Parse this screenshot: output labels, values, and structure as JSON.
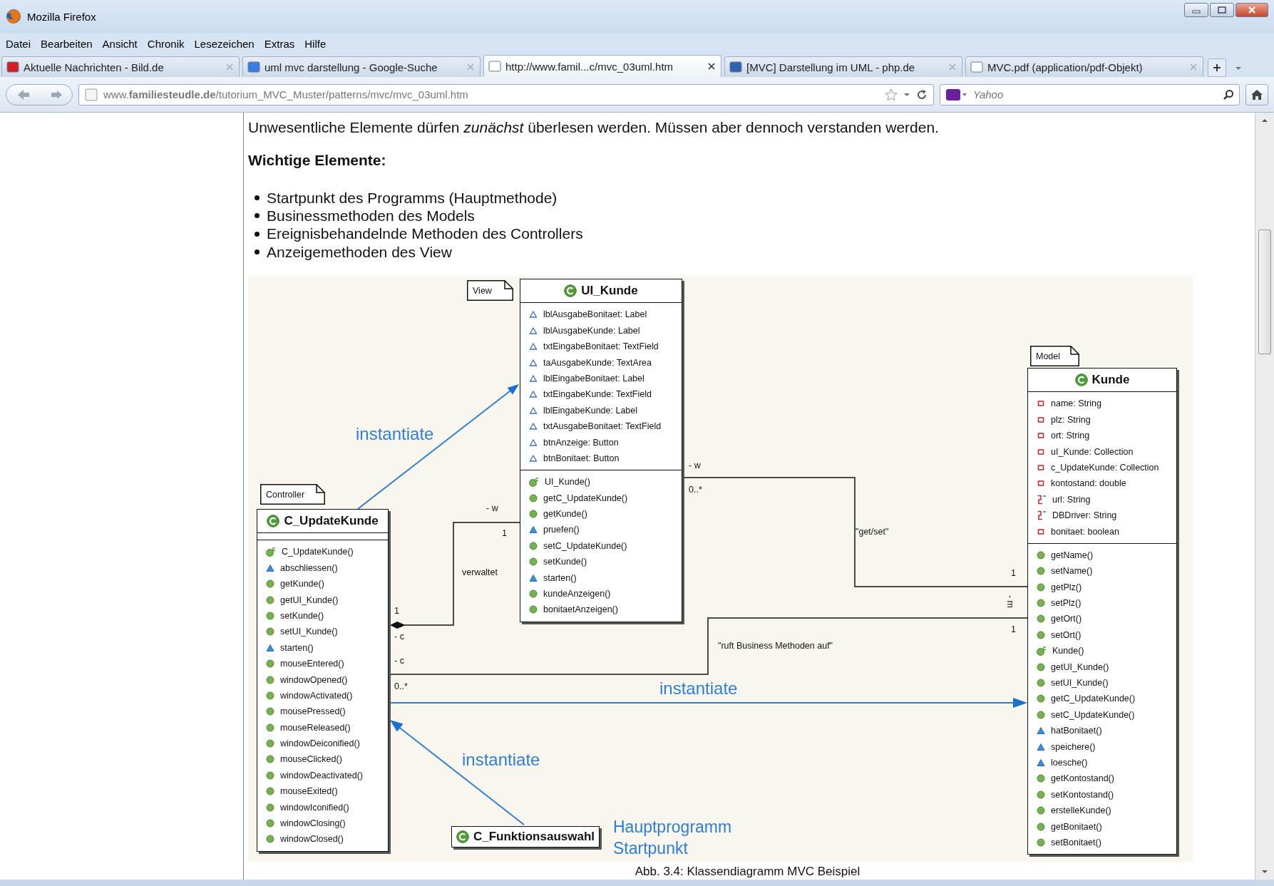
{
  "window": {
    "title": "Mozilla Firefox"
  },
  "menu": [
    "Datei",
    "Bearbeiten",
    "Ansicht",
    "Chronik",
    "Lesezeichen",
    "Extras",
    "Hilfe"
  ],
  "tabs": [
    {
      "label": "Aktuelle Nachrichten - Bild.de",
      "selected": false
    },
    {
      "label": "uml mvc darstellung - Google-Suche",
      "selected": false
    },
    {
      "label": "http://www.famil...c/mvc_03uml.htm",
      "selected": true
    },
    {
      "label": "[MVC] Darstellung im UML - php.de",
      "selected": false
    },
    {
      "label": "MVC.pdf (application/pdf-Objekt)",
      "selected": false
    }
  ],
  "address_bar": {
    "url": "www.**familiesteudle.de**/tutorium_MVC_Muster/patterns/mvc/mvc_03uml.htm"
  },
  "search": {
    "placeholder": "Yahoo"
  },
  "page": {
    "intro": "Unwesentliche Elemente dürfen *zunächst* überlesen werden. Müssen aber dennoch verstanden werden.",
    "heading": "Wichtige Elemente:",
    "bullets": [
      "Startpunkt des Programms (Hauptmethode)",
      "Businessmethoden des Models",
      "Ereignisbehandelnde Methoden des Controllers",
      "Anzeigemethoden des View"
    ],
    "diagram": {
      "packages": [
        "View",
        "Controller",
        "Model"
      ],
      "classes": [
        {
          "name": "UI_Kunde",
          "attributes": [
            {
              "kind": "package-field",
              "text": "lblAusgabeBonitaet: Label"
            },
            {
              "kind": "package-field",
              "text": "lblAusgabeKunde: Label"
            },
            {
              "kind": "package-field",
              "text": "txtEingabeBonitaet: TextField"
            },
            {
              "kind": "package-field",
              "text": "taAusgabeKunde: TextArea"
            },
            {
              "kind": "package-field",
              "text": "lblEingabeBonitaet: Label"
            },
            {
              "kind": "package-field",
              "text": "txtEingabeKunde: TextField"
            },
            {
              "kind": "package-field",
              "text": "lblEingabeKunde: Label"
            },
            {
              "kind": "package-field",
              "text": "txtAusgabeBonitaet: TextField"
            },
            {
              "kind": "package-field",
              "text": "btnAnzeige: Button"
            },
            {
              "kind": "package-field",
              "text": "btnBonitaet: Button"
            }
          ],
          "methods": [
            {
              "kind": "constructor",
              "text": "UI_Kunde()"
            },
            {
              "kind": "public",
              "text": "getC_UpdateKunde()"
            },
            {
              "kind": "public",
              "text": "getKunde()"
            },
            {
              "kind": "package",
              "text": "pruefen()"
            },
            {
              "kind": "public",
              "text": "setC_UpdateKunde()"
            },
            {
              "kind": "public",
              "text": "setKunde()"
            },
            {
              "kind": "package",
              "text": "starten()"
            },
            {
              "kind": "public",
              "text": "kundeAnzeigen()"
            },
            {
              "kind": "public",
              "text": "bonitaetAnzeigen()"
            }
          ]
        },
        {
          "name": "C_UpdateKunde",
          "methods": [
            {
              "kind": "constructor",
              "text": "C_UpdateKunde()"
            },
            {
              "kind": "package",
              "text": "abschliessen()"
            },
            {
              "kind": "public",
              "text": "getKunde()"
            },
            {
              "kind": "public",
              "text": "getUI_Kunde()"
            },
            {
              "kind": "public",
              "text": "setKunde()"
            },
            {
              "kind": "public",
              "text": "setUI_Kunde()"
            },
            {
              "kind": "package",
              "text": "starten()"
            },
            {
              "kind": "public",
              "text": "mouseEntered()"
            },
            {
              "kind": "public",
              "text": "windowOpened()"
            },
            {
              "kind": "public",
              "text": "windowActivated()"
            },
            {
              "kind": "public",
              "text": "mousePressed()"
            },
            {
              "kind": "public",
              "text": "mouseReleased()"
            },
            {
              "kind": "public",
              "text": "windowDeiconified()"
            },
            {
              "kind": "public",
              "text": "mouseClicked()"
            },
            {
              "kind": "public",
              "text": "windowDeactivated()"
            },
            {
              "kind": "public",
              "text": "mouseExited()"
            },
            {
              "kind": "public",
              "text": "windowIconified()"
            },
            {
              "kind": "public",
              "text": "windowClosing()"
            },
            {
              "kind": "public",
              "text": "windowClosed()"
            }
          ]
        },
        {
          "name": "Kunde",
          "attributes": [
            {
              "kind": "private",
              "text": "name: String"
            },
            {
              "kind": "private",
              "text": "plz: String"
            },
            {
              "kind": "private",
              "text": "ort: String"
            },
            {
              "kind": "private",
              "text": "uI_Kunde: Collection"
            },
            {
              "kind": "private",
              "text": "c_UpdateKunde: Collection"
            },
            {
              "kind": "private",
              "text": "kontostand: double"
            },
            {
              "kind": "static",
              "text": "url: String"
            },
            {
              "kind": "static",
              "text": "DBDriver: String"
            },
            {
              "kind": "private",
              "text": "bonitaet: boolean"
            }
          ],
          "methods": [
            {
              "kind": "public",
              "text": "getName()"
            },
            {
              "kind": "public",
              "text": "setName()"
            },
            {
              "kind": "public",
              "text": "getPlz()"
            },
            {
              "kind": "public",
              "text": "setPlz()"
            },
            {
              "kind": "public",
              "text": "getOrt()"
            },
            {
              "kind": "public",
              "text": "setOrt()"
            },
            {
              "kind": "constructor",
              "text": "Kunde()"
            },
            {
              "kind": "public",
              "text": "getUI_Kunde()"
            },
            {
              "kind": "public",
              "text": "setUI_Kunde()"
            },
            {
              "kind": "public",
              "text": "getC_UpdateKunde()"
            },
            {
              "kind": "public",
              "text": "setC_UpdateKunde()"
            },
            {
              "kind": "package",
              "text": "hatBonitaet()"
            },
            {
              "kind": "package",
              "text": "speichere()"
            },
            {
              "kind": "package",
              "text": "loesche()"
            },
            {
              "kind": "public",
              "text": "getKontostand()"
            },
            {
              "kind": "public",
              "text": "setKontostand()"
            },
            {
              "kind": "public",
              "text": "erstelleKunde()"
            },
            {
              "kind": "public",
              "text": "getBonitaet()"
            },
            {
              "kind": "public",
              "text": "setBonitaet()"
            }
          ]
        },
        {
          "name": "C_Funktionsauswahl"
        }
      ],
      "arrow_labels": [
        "instantiate",
        "instantiate",
        "instantiate"
      ],
      "connector_labels": [
        "verwaltet",
        "- w",
        "1",
        "1",
        "- c",
        "- c",
        "0..*",
        "- w",
        "0..*",
        "\"get/set\"",
        "1",
        "- m",
        "1",
        "\"ruft Business Methoden auf\""
      ],
      "note_lines": [
        "Hauptprogramm",
        "Startpunkt"
      ]
    },
    "caption": "Abb. 3.4: Klassendiagramm MVC Beispiel"
  }
}
